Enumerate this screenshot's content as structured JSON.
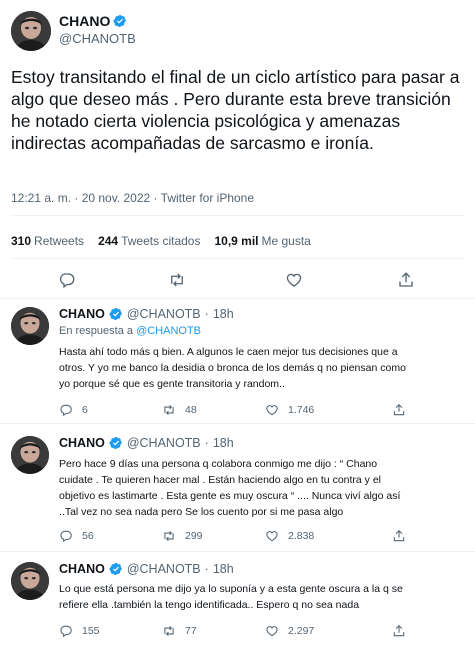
{
  "main_tweet": {
    "name": "CHANO",
    "handle": "@CHANOTB",
    "text": "Estoy transitando el final de un ciclo artístico para pasar a algo que deseo más  . Pero durante esta breve transición he notado cierta violencia psicológica y amenazas indirectas acompañadas de sarcasmo e ironía.",
    "meta": "12:21 a. m. · 20 nov. 2022 · Twitter for iPhone",
    "stats": [
      {
        "count": "310",
        "label": "Retweets"
      },
      {
        "count": "244",
        "label": "Tweets citados"
      },
      {
        "count": "10,9 mil",
        "label": "Me gusta"
      }
    ],
    "actions": [
      "reply-icon",
      "retweet-icon",
      "like-icon",
      "share-icon"
    ]
  },
  "replies": [
    {
      "name": "CHANO",
      "handle": "@CHANOTB",
      "dot": "·",
      "time": "18h",
      "in_reply_prefix": "En respuesta a",
      "in_reply_to": "@CHANOTB",
      "lines": [
        "Hasta ahí todo más q bien. A algunos le caen mejor tus decisiones que a",
        "otros. Y yo me banco la desidia o bronca de los demás q no piensan como",
        "yo  porque sé que es gente transitoria y random.."
      ],
      "reply_count": "6",
      "retweet_count": "48",
      "like_count": "1.746"
    },
    {
      "name": "CHANO",
      "handle": "@CHANOTB",
      "dot": "·",
      "time": "18h",
      "lines": [
        "Pero hace 9 días una persona q colabora conmigo me dijo : “ Chano",
        "cuidate . Te quieren hacer mal . Están haciendo algo en tu contra y el",
        "objetivo es lastimarte . Esta gente es muy oscura “ .... Nunca viví algo así",
        "..Tal vez no sea nada pero  Se los cuento por si me pasa algo"
      ],
      "reply_count": "56",
      "retweet_count": "299",
      "like_count": "2.838"
    },
    {
      "name": "CHANO",
      "handle": "@CHANOTB",
      "dot": "·",
      "time": "18h",
      "lines": [
        "Lo que está persona me dijo ya lo suponía y a esta gente oscura a la q se",
        "refiere ella .también la tengo identificada.. Espero q no sea nada"
      ],
      "reply_count": "155",
      "retweet_count": "77",
      "like_count": "2.297"
    }
  ],
  "colors": {
    "verified": "#1d9bf0",
    "secondary_text": "#536471",
    "link": "#1d9bf0"
  }
}
